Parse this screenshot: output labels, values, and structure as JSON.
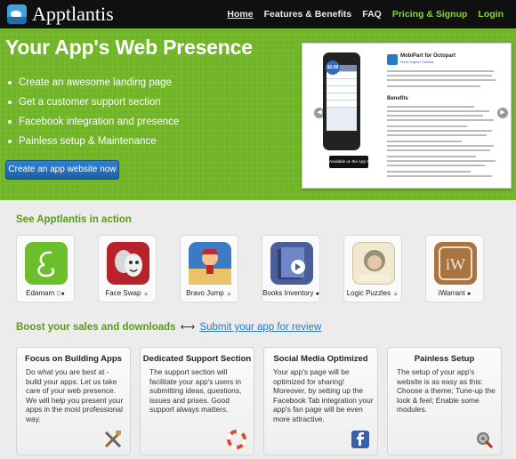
{
  "brand": {
    "name": "Apptlantis"
  },
  "nav": [
    {
      "label": "Home",
      "active": true
    },
    {
      "label": "Features & Benefits"
    },
    {
      "label": "FAQ"
    },
    {
      "label": "Pricing & Signup",
      "accent": "#8cd33a"
    },
    {
      "label": "Login",
      "accent": "#8cd33a"
    }
  ],
  "hero": {
    "title": "Your App's Web Presence",
    "bullets": [
      "Create an awesome landing page",
      "Get a customer support section",
      "Facebook integration and presence",
      "Painless setup & Maintenance"
    ],
    "cta": "Create an app website now",
    "preview": {
      "app_name": "MobiPart for Octopart",
      "links": "Home   Support   Contacts",
      "price": "$2.99",
      "store_badge": "Available on the App Store",
      "heading": "Benefits"
    }
  },
  "apps_section": {
    "title": "See Apptlantis in action",
    "apps": [
      {
        "name": "Edamam",
        "platform": "apple-icon",
        "color": "#6cbf2a"
      },
      {
        "name": "Face Swap",
        "platform": "android-icon",
        "color": "#b8222a"
      },
      {
        "name": "Bravo Jump",
        "platform": "android-icon",
        "color": "#3c7ac4"
      },
      {
        "name": "Books Inventory",
        "platform": "apple-icon",
        "color": "#4a5f9a"
      },
      {
        "name": "Logic Puzzles",
        "platform": "android-icon",
        "color": "#f0e8d0",
        "icon_text": "Logic Puzzles"
      },
      {
        "name": "iWarrant",
        "platform": "apple-icon",
        "color": "#a87442",
        "icon_text": "iW"
      }
    ]
  },
  "boost": {
    "text": "Boost your sales and downloads",
    "sep": "⟷",
    "link": "Submit your app for review"
  },
  "features": [
    {
      "title": "Focus on Building Apps",
      "body": "Do what you are best at - build your apps. Let us take care of your web presence. We will help you present your apps in the most professional way.",
      "icon": "tools-icon"
    },
    {
      "title": "Dedicated Support Section",
      "body": "The support section will facilitate your app's users in submitting ideas, questions, issues and prises. Good support always matters.",
      "icon": "lifebuoy-icon"
    },
    {
      "title": "Social Media Optimized",
      "body": "Your app's page will be optimized for sharing! Moreover, by setting up the Facebook Tab integration your app's fan page will be even more attractive.",
      "icon": "facebook-icon"
    },
    {
      "title": "Painless Setup",
      "body": "The setup of your app's website is as easy as this: Choose a theme; Tune-up the look & feel; Enable some modules.",
      "icon": "settings-icon"
    }
  ]
}
